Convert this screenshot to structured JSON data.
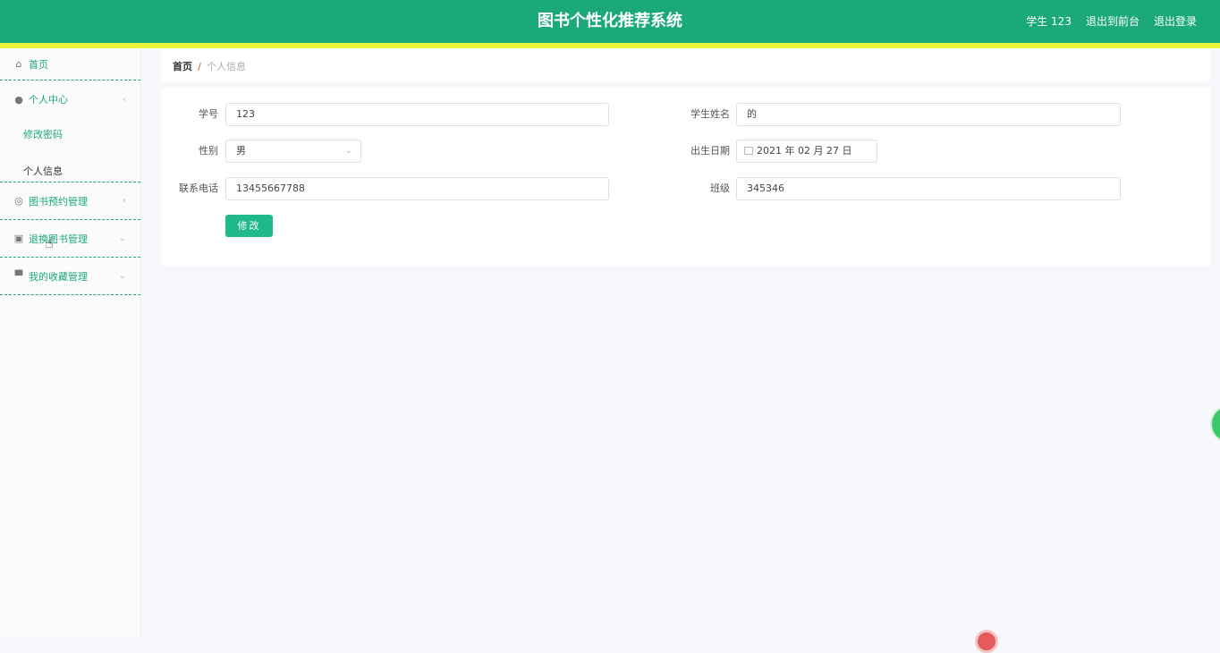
{
  "header": {
    "title": "图书个性化推荐系统",
    "user": "学生 123",
    "exit_front": "退出到前台",
    "logout": "退出登录"
  },
  "sidebar": {
    "home": "首页",
    "personal_center": "个人中心",
    "change_password": "修改密码",
    "personal_info": "个人信息",
    "book_reservation": "图书预约管理",
    "return_books": "退换图书管理",
    "favorites": "我的收藏管理"
  },
  "breadcrumb": {
    "home": "首页",
    "separator": "/",
    "current": "个人信息"
  },
  "form": {
    "student_id_label": "学号",
    "student_id_value": "123",
    "student_name_label": "学生姓名",
    "student_name_value": "的",
    "gender_label": "性别",
    "gender_value": "男",
    "birth_label": "出生日期",
    "birth_value": "2021 年 02 月 27 日",
    "phone_label": "联系电话",
    "phone_value": "13455667788",
    "class_label": "班级",
    "class_value": "345346",
    "submit": "修改"
  },
  "colors": {
    "primary": "#1ba97a",
    "stripe": "#e8f53a",
    "button": "#1fb98a"
  },
  "icons": [
    "home-icon",
    "user-icon",
    "reservation-icon",
    "return-icon",
    "favorites-icon",
    "calendar-icon",
    "chevron-down-icon",
    "chevron-left-icon"
  ]
}
